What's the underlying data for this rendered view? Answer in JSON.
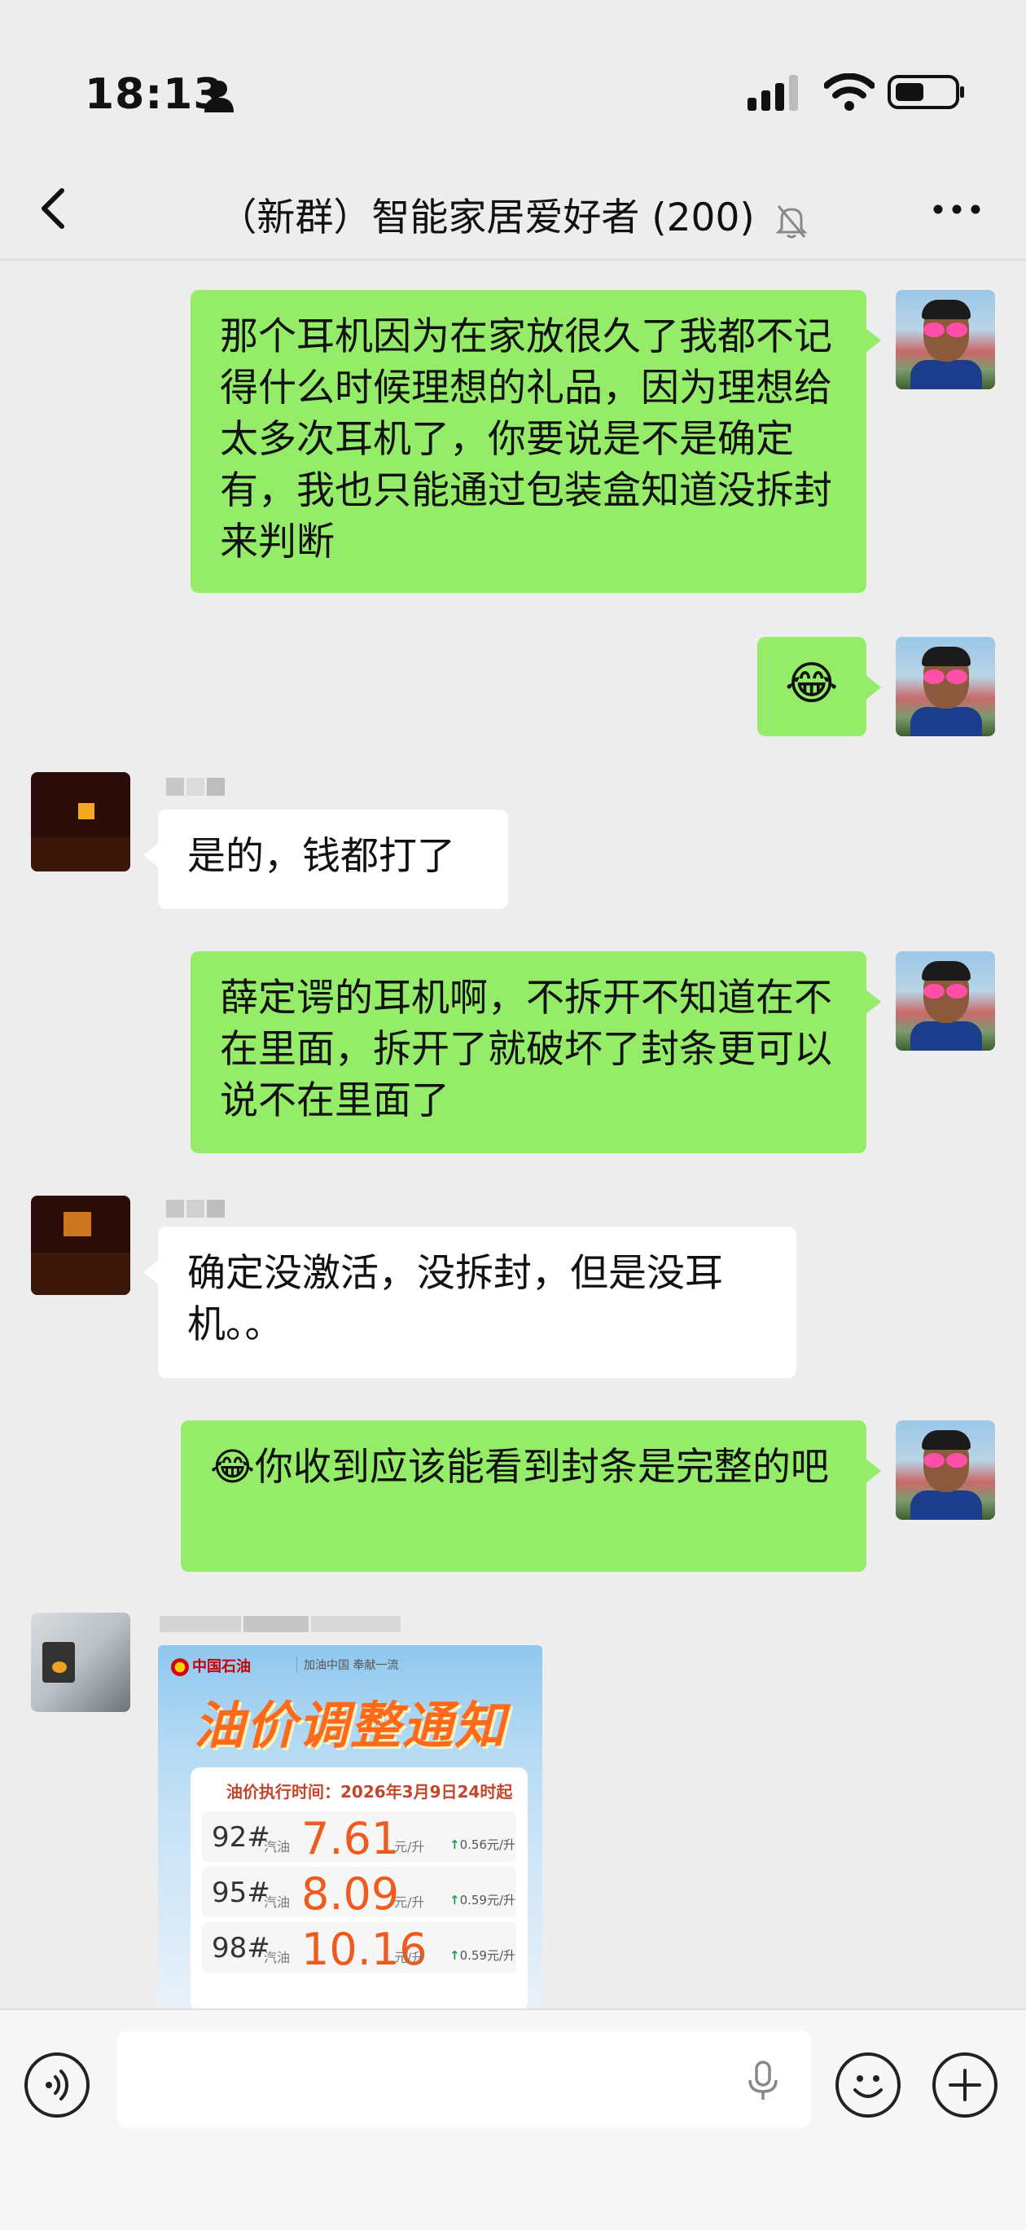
{
  "status_bar": {
    "time": "18:13"
  },
  "header": {
    "title": "（新群）智能家居爱好者 (200)"
  },
  "messages": [
    {
      "from": "me",
      "text": "那个耳机因为在家放很久了我都不记得什么时候理想的礼品，因为理想给太多次耳机了，你要说是不是确定有，我也只能通过包装盒知道没拆封来判断"
    },
    {
      "from": "me",
      "text": "😂"
    },
    {
      "from": "other",
      "text": "是的，钱都打了"
    },
    {
      "from": "me",
      "text": "薛定谔的耳机啊，不拆开不知道在不在里面，拆开了就破坏了封条更可以说不在里面了"
    },
    {
      "from": "other",
      "text": "确定没激活，没拆封，但是没耳机。。"
    },
    {
      "from": "me",
      "text": "😂你收到应该能看到封条是完整的吧"
    }
  ],
  "poster": {
    "brand": "中国石油",
    "slogan": "加油中国 奉献一流",
    "title": "油价调整通知",
    "exec_time": "油价执行时间：2026年3月9日24时起",
    "rows": [
      {
        "grade": "92#",
        "kind": "汽油",
        "price": "7.61",
        "unit": "元/升",
        "delta": "0.56元/升"
      },
      {
        "grade": "95#",
        "kind": "汽油",
        "price": "8.09",
        "unit": "元/升",
        "delta": "0.59元/升"
      },
      {
        "grade": "98#",
        "kind": "汽油",
        "price": "10.16",
        "unit": "元/升",
        "delta": "0.59元/升"
      }
    ]
  }
}
